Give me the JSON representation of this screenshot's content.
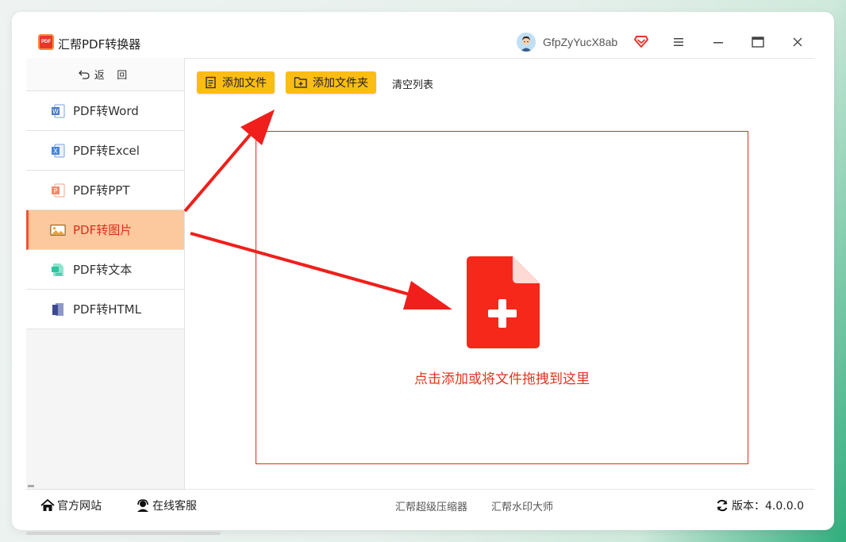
{
  "app": {
    "title": "汇帮PDF转换器",
    "logo_text": "PDF"
  },
  "user": {
    "name": "GfpZyYucX8ab"
  },
  "window_controls": {
    "menu": "menu",
    "minimize": "minimize",
    "maximize": "maximize",
    "close": "close"
  },
  "sidebar": {
    "back_label": "返 回",
    "items": [
      {
        "label": "PDF转Word",
        "icon": "word-icon",
        "active": false
      },
      {
        "label": "PDF转Excel",
        "icon": "excel-icon",
        "active": false
      },
      {
        "label": "PDF转PPT",
        "icon": "ppt-icon",
        "active": false
      },
      {
        "label": "PDF转图片",
        "icon": "image-icon",
        "active": true
      },
      {
        "label": "PDF转文本",
        "icon": "text-icon",
        "active": false
      },
      {
        "label": "PDF转HTML",
        "icon": "html-icon",
        "active": false
      }
    ]
  },
  "toolbar": {
    "add_file": "添加文件",
    "add_folder": "添加文件夹",
    "clear_list": "清空列表"
  },
  "dropzone": {
    "hint": "点击添加或将文件拖拽到这里"
  },
  "footer": {
    "official_site": "官方网站",
    "online_service": "在线客服",
    "link1": "汇帮超级压缩器",
    "link2": "汇帮水印大师",
    "version_label": "版本：4.0.0.0"
  },
  "colors": {
    "accent": "#fbbd14",
    "active_bg": "#fcc89d",
    "red": "#e4351f",
    "arrow": "#f01f1b"
  }
}
